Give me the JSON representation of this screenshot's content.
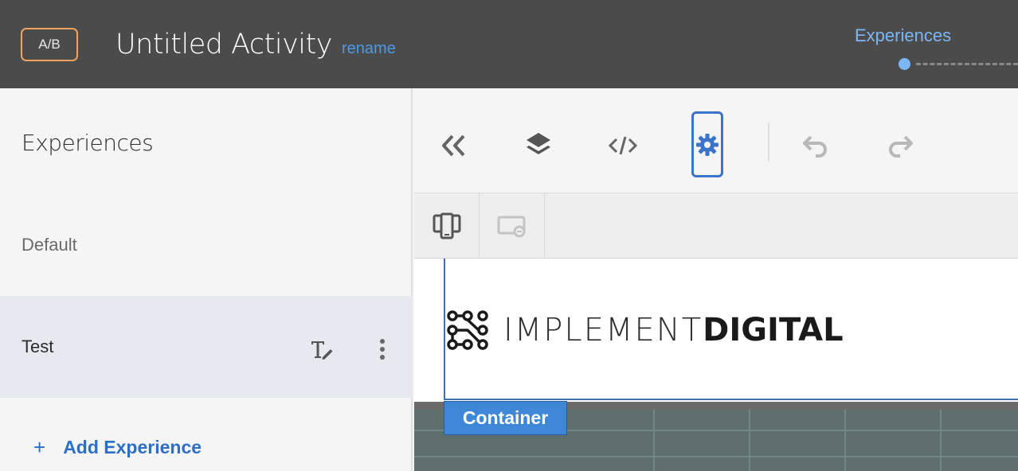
{
  "header": {
    "badge": "A/B",
    "title": "Untitled Activity",
    "rename_link": "rename",
    "step_label": "Experiences"
  },
  "sidebar": {
    "title": "Experiences",
    "items": [
      {
        "label": "Default"
      },
      {
        "label": "Test"
      }
    ],
    "add_experience": "Add Experience",
    "add_icon": "+"
  },
  "toolbar": {
    "icons": [
      "collapse-double-chevron-icon",
      "layers-icon",
      "code-icon",
      "gear-icon",
      "undo-icon",
      "redo-icon"
    ]
  },
  "device_bar": {
    "icons": [
      "device-preview-icon",
      "screen-remove-icon"
    ]
  },
  "canvas": {
    "logo_light": "IMPLEMENT",
    "logo_bold": "DIGITAL",
    "container_label": "Container"
  },
  "colors": {
    "header_bg": "#4b4b4b",
    "accent_blue": "#2d6fc6",
    "badge_orange": "#f0a261",
    "selected_row": "#e6e9f0",
    "container_label_bg": "#3e87d6"
  }
}
